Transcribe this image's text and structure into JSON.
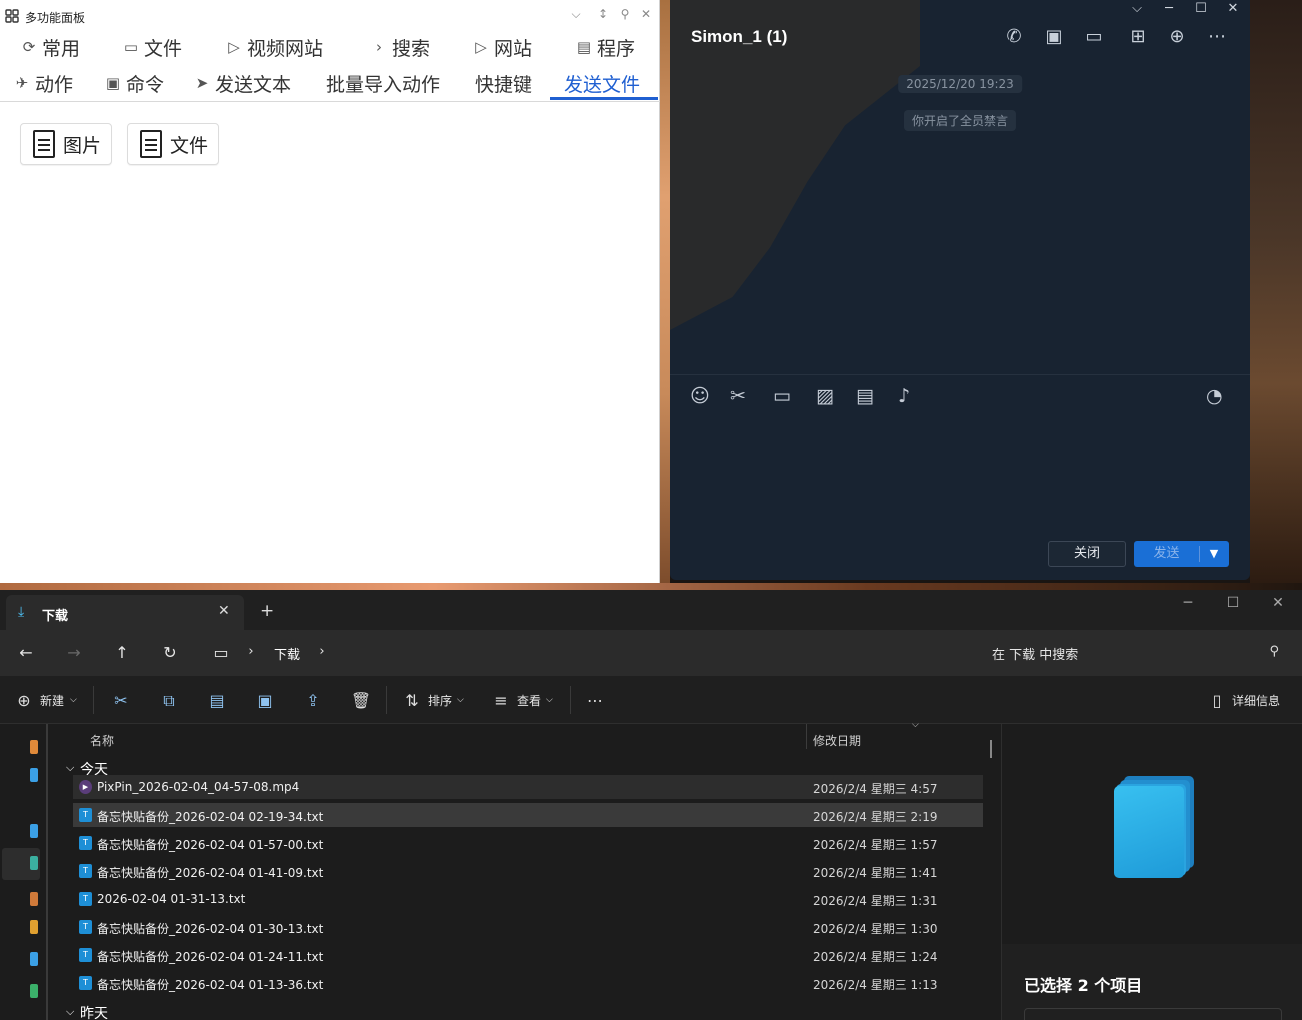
{
  "panel": {
    "title": "多功能面板",
    "tabs_row1": [
      {
        "icon": "⟳",
        "label": "常用",
        "icon_name": "refresh-icon"
      },
      {
        "icon": "▭",
        "label": "文件",
        "icon_name": "folder-icon"
      },
      {
        "icon": "▷",
        "label": "视频网站",
        "icon_name": "video-icon"
      },
      {
        "icon": "›",
        "label": "搜索",
        "icon_name": "chevron-icon"
      },
      {
        "icon": "▷",
        "label": "网站",
        "icon_name": "video-icon"
      },
      {
        "icon": "▤",
        "label": "程序",
        "icon_name": "window-icon"
      }
    ],
    "tabs_row2": [
      {
        "icon": "✈",
        "label": "动作",
        "icon_name": "rocket-icon"
      },
      {
        "icon": "▣",
        "label": "命令",
        "icon_name": "robot-icon"
      },
      {
        "icon": "➤",
        "label": "发送文本",
        "icon_name": "send-icon"
      },
      {
        "icon": "",
        "label": "批量导入动作",
        "icon_name": ""
      },
      {
        "icon": "",
        "label": "快捷键",
        "icon_name": ""
      },
      {
        "icon": "",
        "label": "发送文件",
        "icon_name": ""
      }
    ],
    "active_tab": "发送文件",
    "buttons": [
      "图片",
      "文件"
    ]
  },
  "chat": {
    "title": "Simon_1 (1)",
    "timestamp": "2025/12/20 19:23",
    "system_message": "你开启了全员禁言",
    "close_label": "关闭",
    "send_label": "发送"
  },
  "explorer": {
    "tab_label": "下载",
    "breadcrumb": "下载",
    "search_placeholder": "在 下载 中搜索",
    "toolbar": {
      "new_label": "新建",
      "sort_label": "排序",
      "view_label": "查看",
      "details_label": "详细信息"
    },
    "columns": {
      "name": "名称",
      "modified": "修改日期"
    },
    "group_today": "今天",
    "group_yesterday": "昨天",
    "files": [
      {
        "name": "PixPin_2026-02-04_04-57-08.mp4",
        "date": "2026/2/4 星期三  4:57",
        "type": "video"
      },
      {
        "name": "备忘快贴备份_2026-02-04 02-19-34.txt",
        "date": "2026/2/4 星期三  2:19",
        "type": "text"
      },
      {
        "name": "备忘快贴备份_2026-02-04 01-57-00.txt",
        "date": "2026/2/4 星期三  1:57",
        "type": "text"
      },
      {
        "name": "备忘快贴备份_2026-02-04 01-41-09.txt",
        "date": "2026/2/4 星期三  1:41",
        "type": "text"
      },
      {
        "name": "2026-02-04 01-31-13.txt",
        "date": "2026/2/4 星期三  1:31",
        "type": "text"
      },
      {
        "name": "备忘快贴备份_2026-02-04 01-30-13.txt",
        "date": "2026/2/4 星期三  1:30",
        "type": "text"
      },
      {
        "name": "备忘快贴备份_2026-02-04 01-24-11.txt",
        "date": "2026/2/4 星期三  1:24",
        "type": "text"
      },
      {
        "name": "备忘快贴备份_2026-02-04 01-13-36.txt",
        "date": "2026/2/4 星期三  1:13",
        "type": "text"
      }
    ],
    "details": {
      "selection_label": "已选择 2 个项目"
    }
  },
  "colors": {
    "accent": "#1f5fd1",
    "chat_bg": "#182331",
    "send_button": "#1a6fd6",
    "explorer_bg": "#1c1c1c",
    "file_icon": "#1e8fd6"
  }
}
